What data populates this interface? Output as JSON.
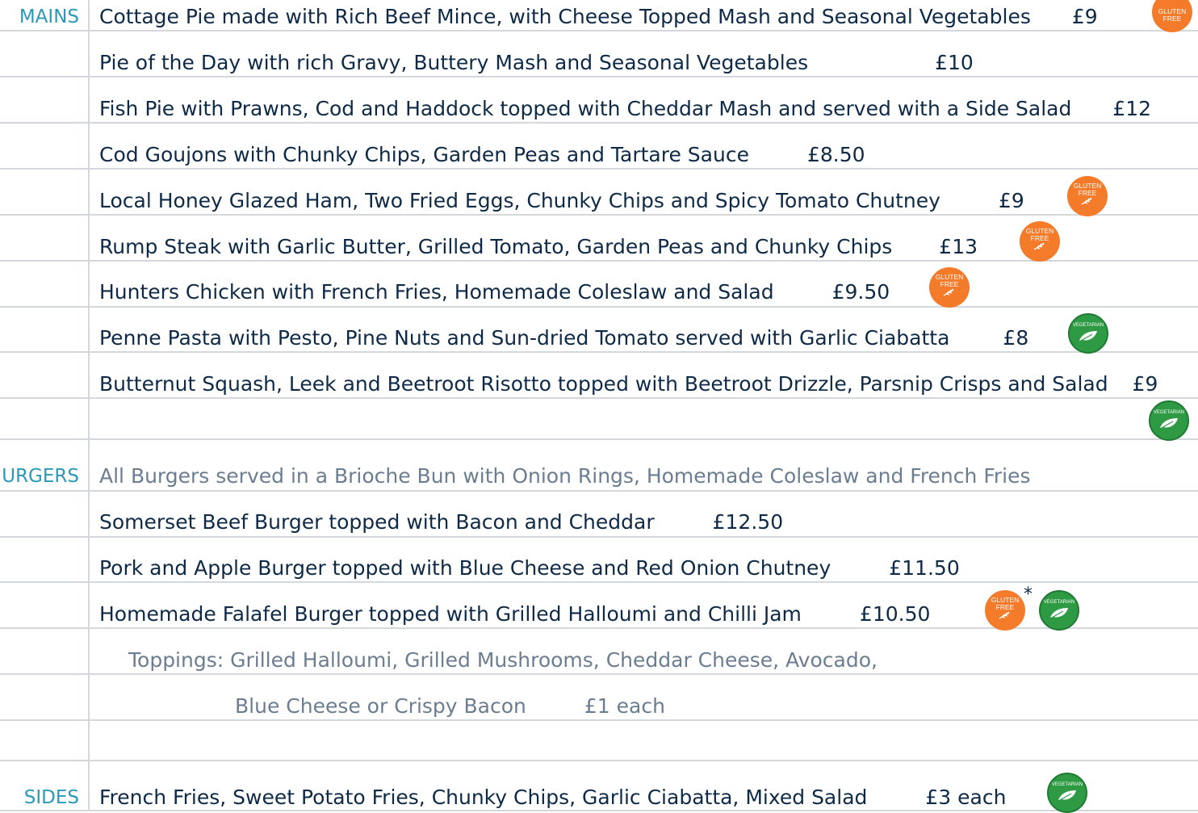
{
  "colors": {
    "section_label": "#2b9ab8",
    "text": "#0e2a47",
    "muted_text": "#6b7d90",
    "rule": "#d4d7dc",
    "gluten_free_badge": "#f47b2a",
    "vegetarian_badge": "#2e9a44"
  },
  "badges": {
    "gluten_free_line1": "GLUTEN",
    "gluten_free_line2": "FREE",
    "vegetarian": "VEGETARIAN"
  },
  "mains": {
    "label": "MAINS",
    "items": [
      {
        "name": "Cottage Pie made with Rich Beef Mince, with Cheese Topped Mash and Seasonal Vegetables",
        "price": "£9"
      },
      {
        "name": "Pie of the Day with rich Gravy, Buttery Mash and Seasonal Vegetables",
        "price": "£10"
      },
      {
        "name": "Fish Pie with Prawns, Cod and Haddock topped with Cheddar Mash and served with a Side Salad",
        "price": "£12"
      },
      {
        "name": "Cod Goujons with Chunky Chips, Garden Peas and Tartare Sauce",
        "price": "£8.50"
      },
      {
        "name": "Local Honey Glazed Ham, Two Fried Eggs, Chunky Chips and Spicy Tomato Chutney",
        "price": "£9"
      },
      {
        "name": "Rump Steak with Garlic Butter, Grilled Tomato, Garden Peas and Chunky Chips",
        "price": "£13"
      },
      {
        "name": "Hunters Chicken with French Fries, Homemade Coleslaw and Salad",
        "price": "£9.50"
      },
      {
        "name": "Penne Pasta with Pesto, Pine Nuts and Sun-dried Tomato served with Garlic Ciabatta",
        "price": "£8"
      },
      {
        "name": "Butternut Squash, Leek and Beetroot Risotto topped with Beetroot Drizzle, Parsnip Crisps and Salad",
        "price": "£9"
      }
    ]
  },
  "burgers": {
    "label": "URGERS",
    "intro": "All Burgers served in a Brioche Bun with Onion Rings, Homemade Coleslaw and French Fries",
    "items": [
      {
        "name": "Somerset Beef Burger topped with Bacon and Cheddar",
        "price": "£12.50"
      },
      {
        "name": "Pork and Apple Burger topped with Blue Cheese and Red Onion Chutney",
        "price": "£11.50"
      },
      {
        "name": "Homemade Falafel Burger topped with Grilled Halloumi and Chilli Jam",
        "price": "£10.50"
      }
    ],
    "gf_asterisk": "*",
    "toppings_line1": "Toppings: Grilled Halloumi, Grilled Mushrooms, Cheddar Cheese, Avocado,",
    "toppings_line2": "Blue Cheese or Crispy Bacon",
    "toppings_price": "£1 each"
  },
  "sides": {
    "label": "SIDES",
    "items": [
      {
        "name": "French Fries, Sweet Potato Fries, Chunky Chips, Garlic Ciabatta, Mixed Salad",
        "price": "£3 each"
      }
    ]
  }
}
